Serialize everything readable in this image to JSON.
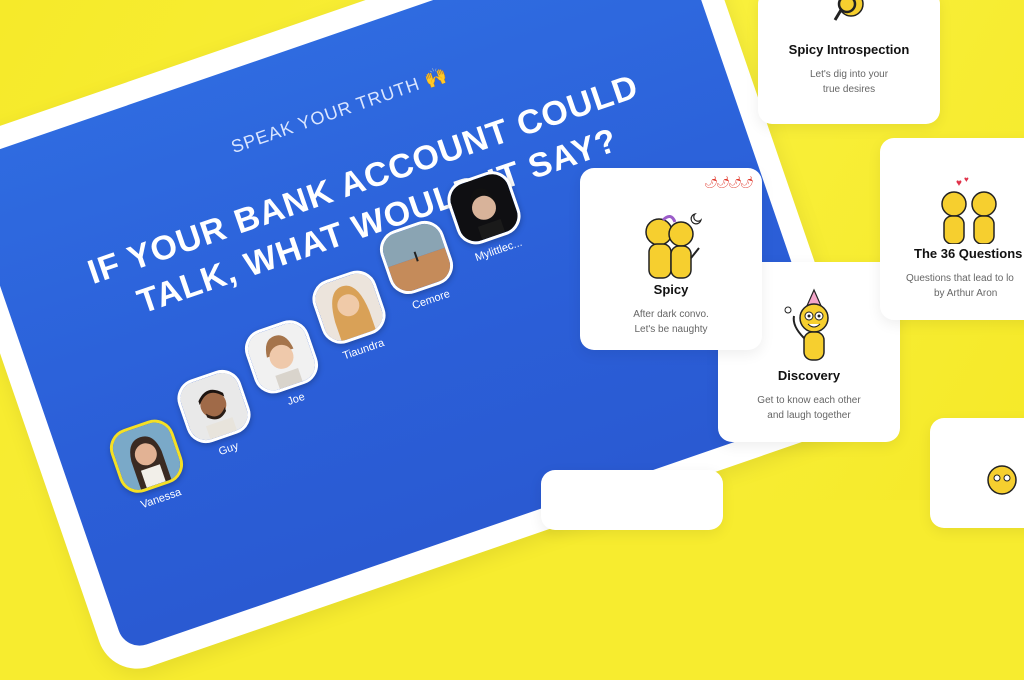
{
  "hero": {
    "tagline": "SPEAK YOUR TRUTH 🙌",
    "question_line1": "IF YOUR BANK ACCOUNT COULD",
    "question_line2": "TALK, WHAT WOULD IT SAY?"
  },
  "people": [
    {
      "name": "Vanessa",
      "selected": true
    },
    {
      "name": "Guy"
    },
    {
      "name": "Joe"
    },
    {
      "name": "Tiaundra"
    },
    {
      "name": "Cemore"
    },
    {
      "name": "Mylittlec..."
    }
  ],
  "cards": {
    "introspection": {
      "title": "Spicy Introspection",
      "desc_line1": "Let's dig into your",
      "desc_line2": "true desires"
    },
    "spicy": {
      "title": "Spicy",
      "desc_line1": "After dark convo.",
      "desc_line2": "Let's be naughty",
      "peppers": "🌶🌶🌶🌶"
    },
    "questions": {
      "title": "The 36 Questions",
      "desc_line1": "Questions that lead to lo",
      "desc_line2": "by Arthur Aron"
    },
    "discovery": {
      "title": "Discovery",
      "desc_line1": "Get to know each other",
      "desc_line2": "and laugh together"
    }
  },
  "colors": {
    "background": "#f7ec2f",
    "screen_blue": "#2d63dc",
    "character_yellow": "#f6cf2f",
    "pepper_red": "#e03a2e"
  }
}
